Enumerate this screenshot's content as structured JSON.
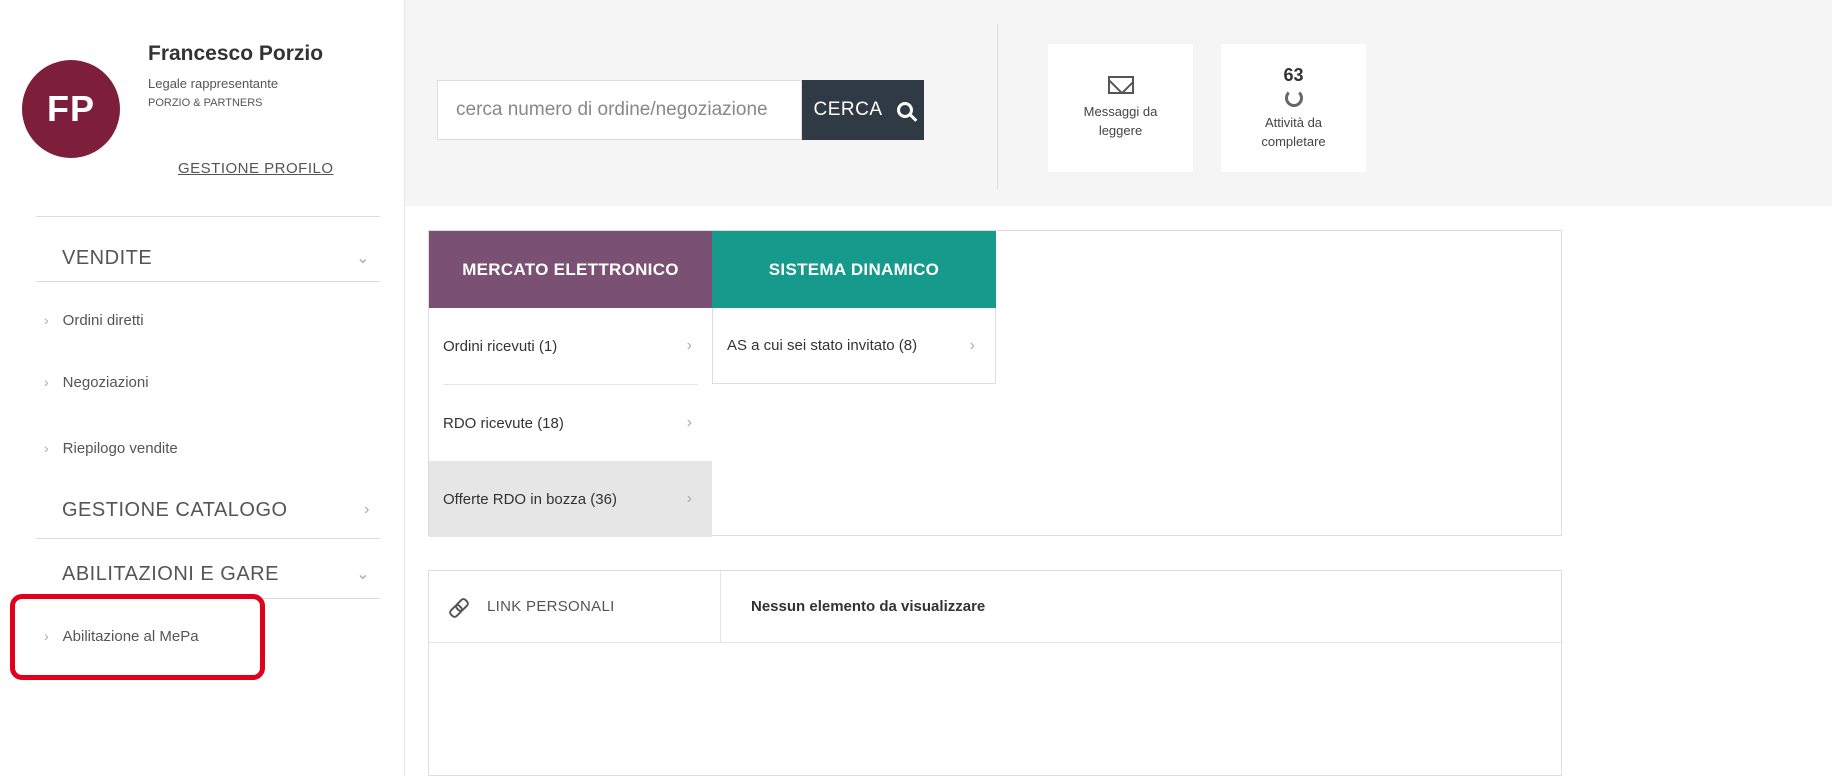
{
  "profile": {
    "initials": "FP",
    "name": "Francesco Porzio",
    "role": "Legale rappresentante",
    "company": "PORZIO & PARTNERS",
    "manage_link": "GESTIONE PROFILO"
  },
  "sidebar": {
    "sections": [
      {
        "label": "VENDITE",
        "chevron": "chevron-down-icon"
      },
      {
        "label": "GESTIONE CATALOGO",
        "chevron": "chevron-right-icon"
      },
      {
        "label": "ABILITAZIONI E GARE",
        "chevron": "chevron-down-icon"
      }
    ],
    "vendite_items": [
      "Ordini diretti",
      "Negoziazioni",
      "Riepilogo vendite"
    ],
    "abilitazioni_items": [
      "Abilitazione al MePa"
    ]
  },
  "search": {
    "placeholder": "cerca numero di ordine/negoziazione",
    "button_label": "CERCA"
  },
  "cards": {
    "messages": {
      "label_line1": "Messaggi da",
      "label_line2": "leggere",
      "icon": "envelope-icon"
    },
    "tasks": {
      "count": "63",
      "label_line1": "Attività da",
      "label_line2": "completare",
      "icon": "spinner-icon"
    }
  },
  "tabs": {
    "mercato": {
      "label": "MERCATO ELETTRONICO",
      "color": "#7b5173",
      "rows": [
        "Ordini ricevuti (1)",
        "RDO ricevute (18)",
        "Offerte RDO in bozza (36)"
      ]
    },
    "sistema": {
      "label": "SISTEMA DINAMICO",
      "color": "#159a8c",
      "rows": [
        "AS a cui sei stato invitato (8)"
      ]
    }
  },
  "links": {
    "label": "LINK PERSONALI",
    "value": "Nessun elemento da visualizzare"
  },
  "colors": {
    "avatar": "#7d1f3a",
    "search_button": "#2f3a45",
    "highlight": "#e0001b"
  }
}
